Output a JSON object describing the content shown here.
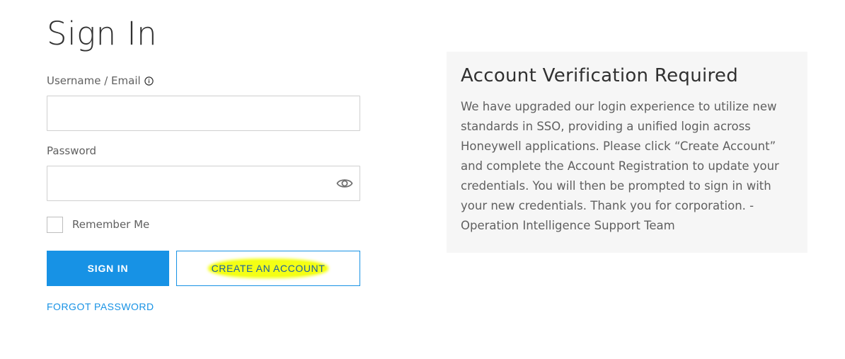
{
  "page": {
    "title": "Sign In"
  },
  "form": {
    "username_label": "Username / Email",
    "username_value": "",
    "password_label": "Password",
    "password_value": "",
    "remember_label": "Remember Me",
    "remember_checked": false,
    "signin_label": "SIGN IN",
    "create_label": "CREATE AN ACCOUNT",
    "forgot_label": "FORGOT PASSWORD"
  },
  "icons": {
    "info": "info-icon",
    "password_toggle": "eye-icon"
  },
  "notice": {
    "title": "Account Verification Required",
    "body": "We have upgraded our login experience to utilize new standards in SSO, providing a unified login across Honeywell applications. Please click “Create Account” and complete the Account Registration to update your credentials. You will then be prompted to sign in with your new credentials. Thank you for corporation. - Operation Intelligence Support Team"
  },
  "colors": {
    "primary": "#1792e5",
    "highlight": "#f4ff14",
    "panel_bg": "#f6f6f6"
  }
}
